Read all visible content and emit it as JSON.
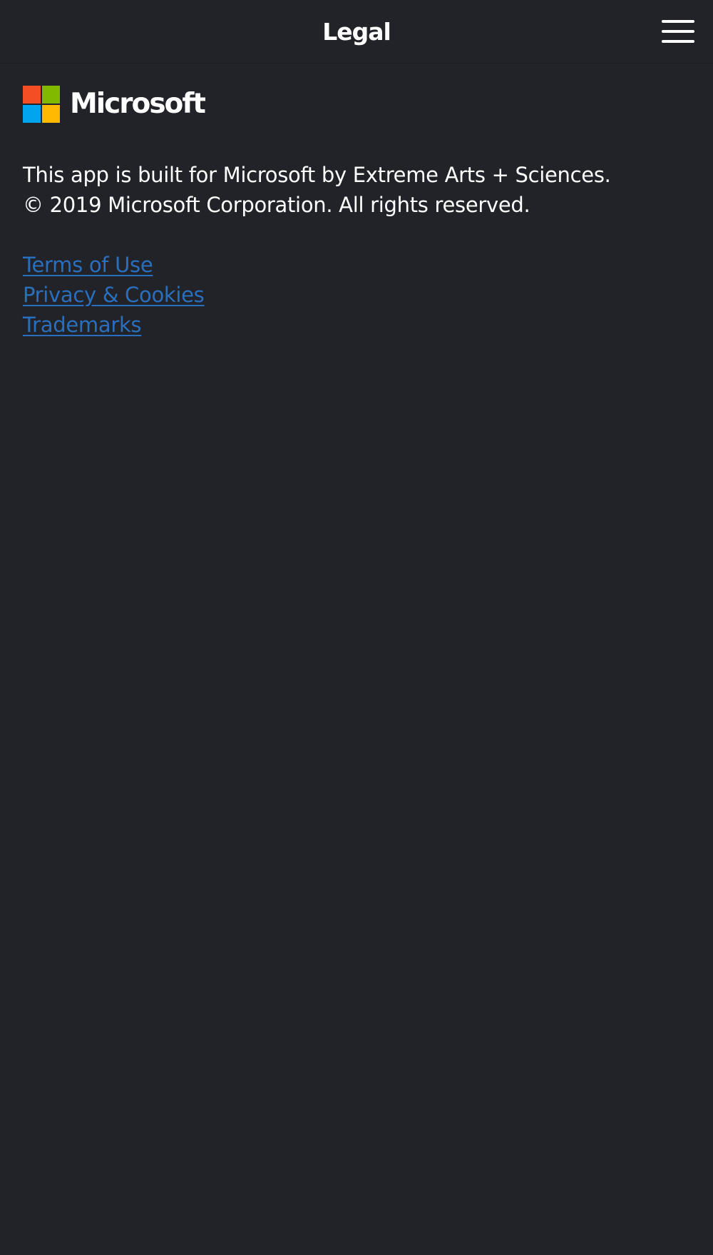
{
  "header": {
    "title": "Legal",
    "menu_icon": "hamburger-menu-icon"
  },
  "logo": {
    "text": "Microsoft",
    "colors": {
      "red": "#f25022",
      "green": "#7fba00",
      "blue": "#00a4ef",
      "yellow": "#ffb900"
    }
  },
  "body": {
    "line1": "This app is built for Microsoft by Extreme Arts + Sciences.",
    "line2": "© 2019 Microsoft Corporation. All rights reserved."
  },
  "links": {
    "terms": "Terms of Use",
    "privacy": "Privacy & Cookies",
    "trademarks": "Trademarks"
  },
  "theme": {
    "background": "#222328",
    "link_color": "#2a6fbd",
    "text_color": "#ffffff"
  }
}
